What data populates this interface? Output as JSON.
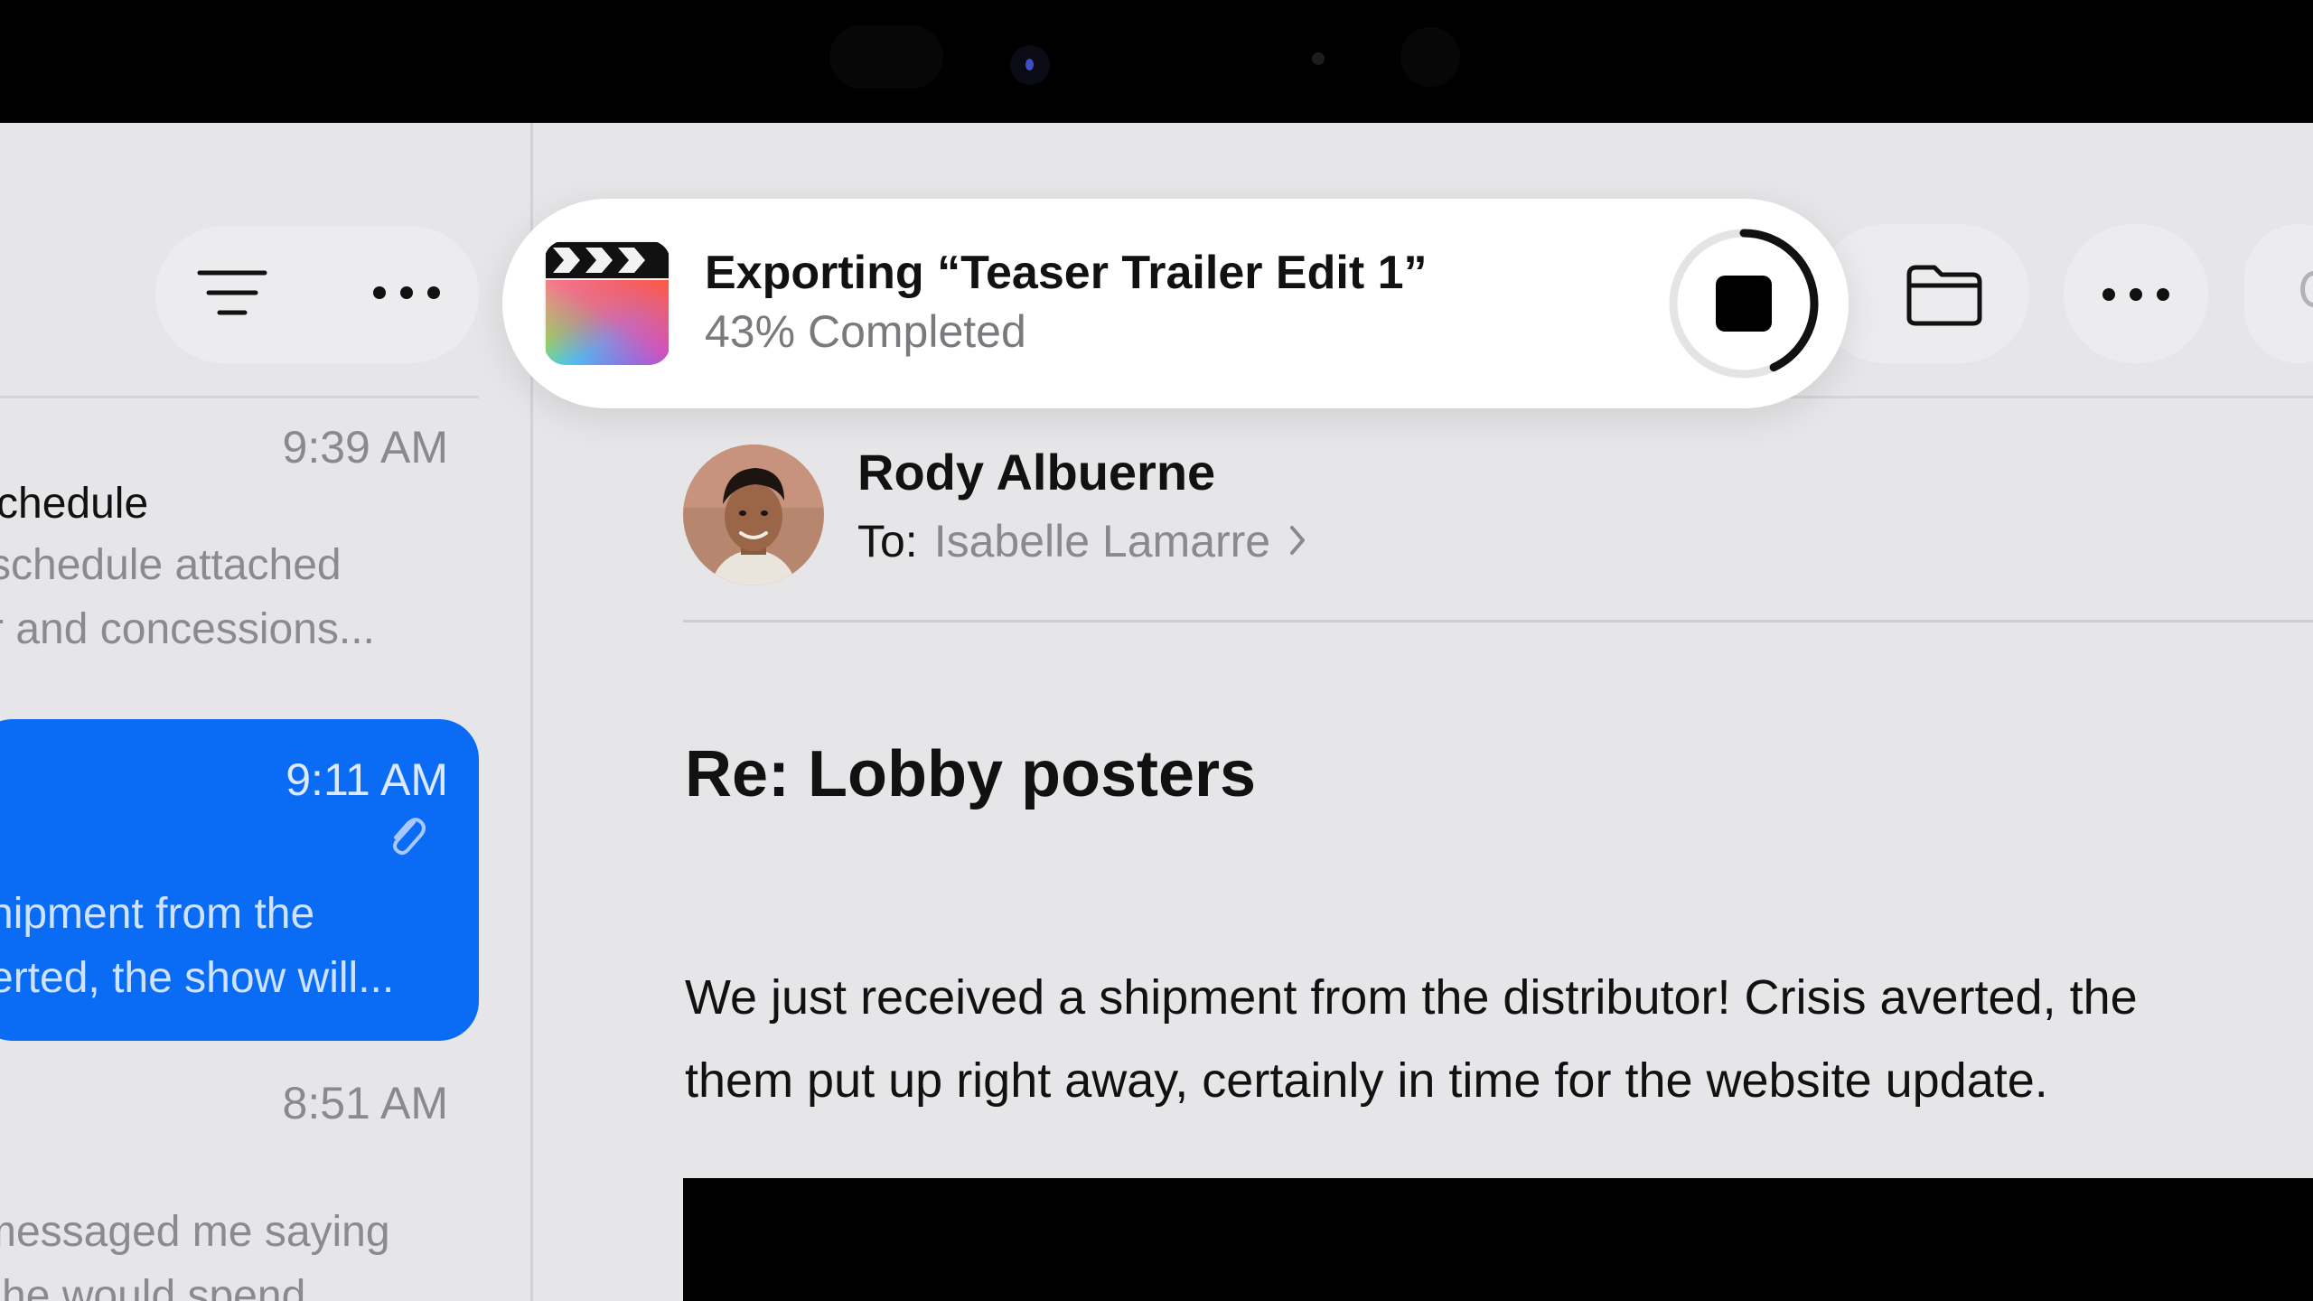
{
  "device": {
    "bezel_color": "#000000"
  },
  "toolbar": {
    "filter_icon": "filter-lines-icon",
    "more_icon": "ellipsis-icon",
    "folder_icon": "folder-icon"
  },
  "mail_list": {
    "items": [
      {
        "time": "9:39 AM",
        "subject": "chedule",
        "preview_lines": [
          "schedule attached",
          "r and concessions..."
        ]
      },
      {
        "time": "9:11 AM",
        "has_attachment": true,
        "selected": true,
        "preview_lines": [
          "hipment from the",
          "erted, the show will..."
        ]
      },
      {
        "time": "8:51 AM",
        "preview_lines": [
          "messaged me saying",
          "she would spend"
        ]
      }
    ]
  },
  "message": {
    "sender": "Rody Albuerne",
    "to_label": "To:",
    "recipient": "Isabelle Lamarre",
    "subject": "Re: Lobby posters",
    "body_lines": [
      "We just received a shipment from the distributor! Crisis averted, the",
      "them put up right away, certainly in time for the website update."
    ]
  },
  "export_toast": {
    "app_icon": "final-cut-pro-clapper-icon",
    "title": "Exporting “Teaser Trailer Edit 1”",
    "status": "43% Completed",
    "progress": 0.43,
    "stop_icon": "stop-square-icon"
  },
  "colors": {
    "accent": "#0a6cf5",
    "background": "#e6e6e8",
    "toast_bg": "#ffffff"
  }
}
